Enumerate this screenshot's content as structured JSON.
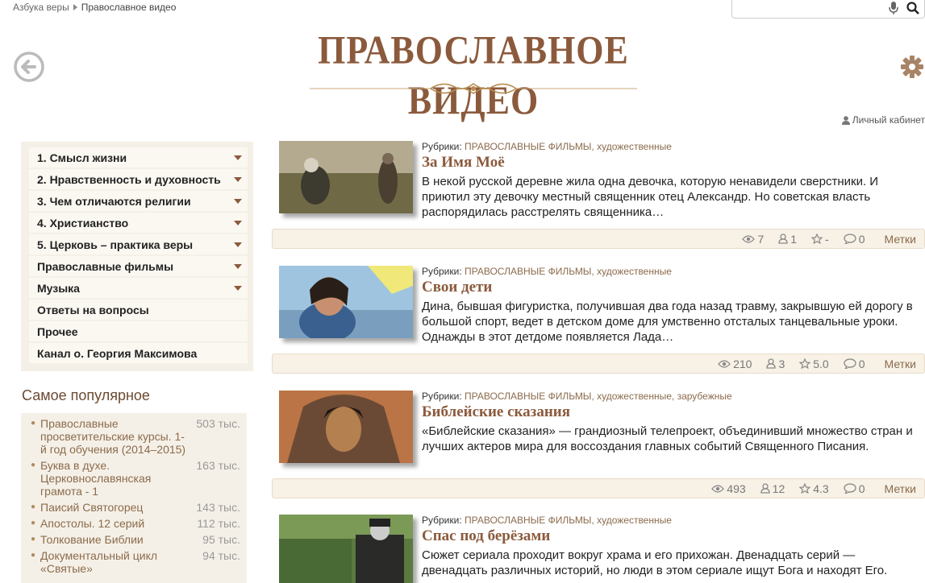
{
  "breadcrumb": {
    "items": [
      "Азбука веры",
      "Православное видео"
    ]
  },
  "search": {
    "placeholder": "",
    "value": ""
  },
  "header": {
    "logo_text": "ПРАВОСЛАВНОЕ ВИДЕО",
    "cabinet_label": "Личный кабинет"
  },
  "icons": {
    "back": "arrow-left-circle-icon",
    "settings": "gear-icon",
    "mic": "microphone-icon",
    "search": "magnifier-icon",
    "user": "user-icon"
  },
  "colors": {
    "brand": "#8b5a3c",
    "panel": "#f5f0e7",
    "link": "#8b6b4c"
  },
  "menu": {
    "items": [
      {
        "label": "1. Смысл жизни",
        "has_submenu": true
      },
      {
        "label": "2. Нравственность и духовность",
        "has_submenu": true
      },
      {
        "label": "3. Чем отличаются религии",
        "has_submenu": true
      },
      {
        "label": "4. Христианство",
        "has_submenu": true
      },
      {
        "label": "5. Церковь – практика веры",
        "has_submenu": true
      },
      {
        "label": "Православные фильмы",
        "has_submenu": true
      },
      {
        "label": "Музыка",
        "has_submenu": true
      },
      {
        "label": "Ответы на вопросы",
        "has_submenu": false
      },
      {
        "label": "Прочее",
        "has_submenu": false
      },
      {
        "label": "Канал о. Георгия Максимова",
        "has_submenu": false
      }
    ]
  },
  "popular": {
    "title": "Самое популярное",
    "items": [
      {
        "label": "Православные просветительские курсы. 1-й год обучения (2014–2015)",
        "count": "503 тыс."
      },
      {
        "label": "Буква в духе. Церковнославянская грамота - 1",
        "count": "163 тыс."
      },
      {
        "label": "Паисий Святогорец",
        "count": "143 тыс."
      },
      {
        "label": "Апостолы. 12 серий",
        "count": "112 тыс."
      },
      {
        "label": "Толкование Библии",
        "count": "95 тыс."
      },
      {
        "label": "Документальный цикл «Святые»",
        "count": "94 тыс."
      }
    ]
  },
  "cards": [
    {
      "rubric_prefix": "Рубрики:",
      "rubrics": "ПРАВОСЛАВНЫЕ ФИЛЬМЫ, художественные",
      "title": "За Имя Моё",
      "description": "В некой русской деревне жила одна девочка, которую ненавидели сверстники. И приютил эту девочку местный священник отец Александр. Но советская власть распорядилась расстрелять священника…",
      "views": "7",
      "users": "1",
      "rating": "-",
      "comments": "0",
      "tags_label": "Метки"
    },
    {
      "rubric_prefix": "Рубрики:",
      "rubrics": "ПРАВОСЛАВНЫЕ ФИЛЬМЫ, художественные",
      "title": "Свои дети",
      "description": "Дина, бывшая фигуристка, получившая два года назад травму, закрывшую ей дорогу в большой спорт, ведет в детском доме для умственно отсталых танцевальные уроки. Однажды в этот детдоме появляется Лада…",
      "views": "210",
      "users": "3",
      "rating": "5.0",
      "comments": "0",
      "tags_label": "Метки"
    },
    {
      "rubric_prefix": "Рубрики:",
      "rubrics": "ПРАВОСЛАВНЫЕ ФИЛЬМЫ, художественные, зарубежные",
      "title": "Библейские сказания",
      "description": "«Библейские сказания» — грандиозный телепроект, объединивший множество стран и лучших актеров мира для воссоздания главных событий Священного Писания.",
      "views": "493",
      "users": "12",
      "rating": "4.3",
      "comments": "0",
      "tags_label": "Метки"
    },
    {
      "rubric_prefix": "Рубрики:",
      "rubrics": "ПРАВОСЛАВНЫЕ ФИЛЬМЫ, художественные",
      "title": "Спас под берёзами",
      "description": "Сюжет сериала проходит вокруг храма и его прихожан. Двенадцать серий — двенадцать различных историй, но люди в этом сериале ищут Бога и находят Его.",
      "views": "",
      "users": "",
      "rating": "",
      "comments": "",
      "tags_label": ""
    }
  ]
}
